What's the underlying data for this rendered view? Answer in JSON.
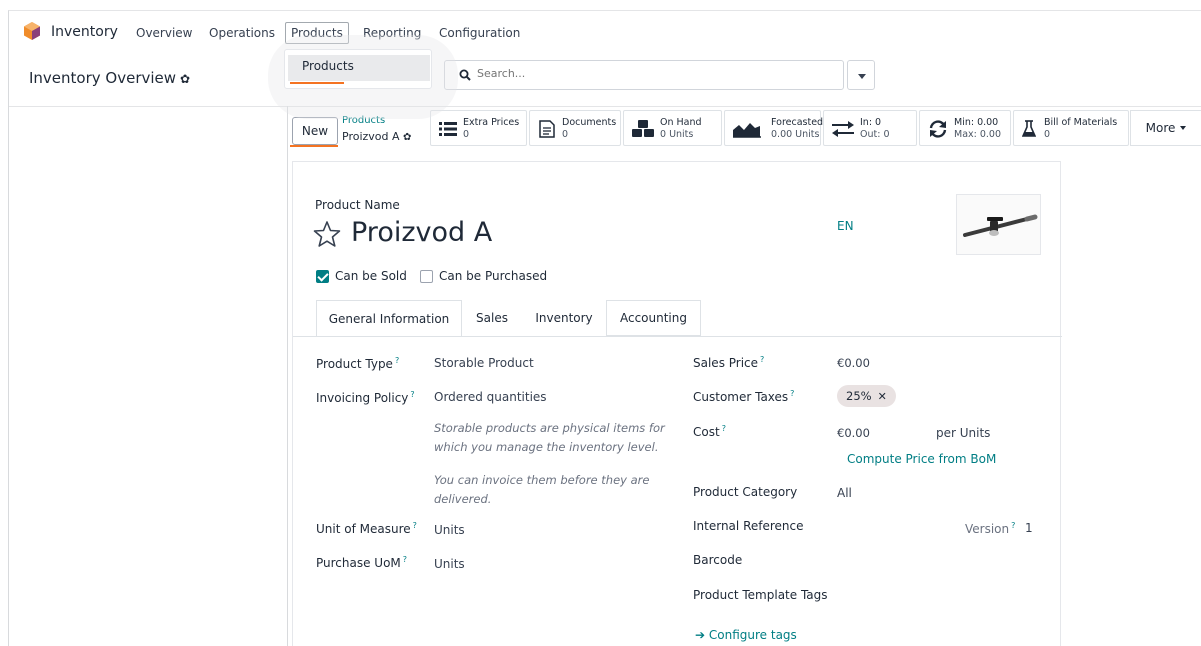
{
  "nav": {
    "app_name": "Inventory",
    "items": [
      "Overview",
      "Operations",
      "Products",
      "Reporting",
      "Configuration"
    ],
    "active": "Products"
  },
  "dropdown": {
    "items": [
      "Products"
    ]
  },
  "breadcrumb": {
    "title": "Inventory Overview"
  },
  "search": {
    "placeholder": "Search..."
  },
  "control": {
    "new_label": "New",
    "breadcrumb_parent": "Products",
    "breadcrumb_current": "Proizvod A",
    "more_label": "More"
  },
  "smart_buttons": [
    {
      "title": "Extra Prices",
      "value": "0",
      "icon": "list-icon"
    },
    {
      "title": "Documents",
      "value": "0",
      "icon": "document-icon"
    },
    {
      "title": "On Hand",
      "value": "0 Units",
      "icon": "cubes-icon"
    },
    {
      "title": "Forecasted",
      "value": "0.00 Units",
      "icon": "area-chart-icon"
    },
    {
      "title": "In: 0",
      "value": "Out: 0",
      "icon": "exchange-icon"
    },
    {
      "title": "Min: 0.00",
      "value": "Max: 0.00",
      "icon": "refresh-icon"
    },
    {
      "title": "Bill of Materials",
      "value": "0",
      "icon": "flask-icon"
    }
  ],
  "form": {
    "product_name_label": "Product Name",
    "product_name": "Proizvod A",
    "lang": "EN",
    "can_be_sold": "Can be Sold",
    "can_be_purchased": "Can be Purchased",
    "tabs": [
      "General Information",
      "Sales",
      "Inventory",
      "Accounting"
    ],
    "left": {
      "product_type_label": "Product Type",
      "product_type": "Storable Product",
      "invoicing_policy_label": "Invoicing Policy",
      "invoicing_policy": "Ordered quantities",
      "note1_line1": "Storable products are physical items for",
      "note1_line2": "which you manage the inventory level.",
      "note2_line1": "You can invoice them before they are",
      "note2_line2": "delivered.",
      "uom_label": "Unit of Measure",
      "uom": "Units",
      "purchase_uom_label": "Purchase UoM",
      "purchase_uom": "Units"
    },
    "right": {
      "sales_price_label": "Sales Price",
      "sales_price": "€0.00",
      "customer_taxes_label": "Customer Taxes",
      "customer_taxes_tag": "25%",
      "cost_label": "Cost",
      "cost": "€0.00",
      "cost_unit": "per Units",
      "compute_price": "Compute Price from BoM",
      "product_category_label": "Product Category",
      "product_category": "All",
      "internal_ref_label": "Internal Reference",
      "version_label": "Version",
      "version": "1",
      "barcode_label": "Barcode",
      "template_tags_label": "Product Template Tags",
      "configure_tags": "Configure tags"
    }
  },
  "colors": {
    "accent": "#017e84",
    "highlight": "#f47322",
    "brand": "#e46e28"
  }
}
